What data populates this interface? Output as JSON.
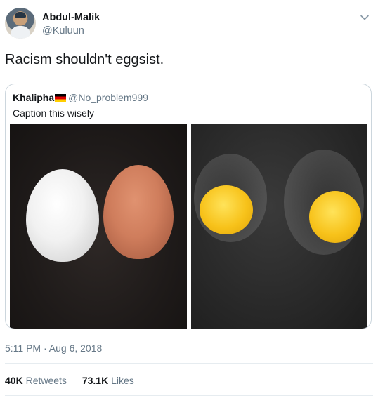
{
  "author": {
    "display_name": "Abdul-Malik",
    "handle": "@Kuluun",
    "avatar": "avatar"
  },
  "tweet": {
    "text": "Racism shouldn't eggsist."
  },
  "quote": {
    "display_name": "Khalipha",
    "flag": "germany-flag",
    "handle": "@No_problem999",
    "text": "Caption this wisely",
    "images": [
      "white and brown eggs",
      "two cracked eggs"
    ]
  },
  "meta": {
    "timestamp": "5:11 PM · Aug 6, 2018"
  },
  "stats": {
    "retweets_count": "40K",
    "retweets_label": "Retweets",
    "likes_count": "73.1K",
    "likes_label": "Likes"
  },
  "colors": {
    "text": "#14171a",
    "secondary": "#657786",
    "border": "#ccd6dd"
  }
}
